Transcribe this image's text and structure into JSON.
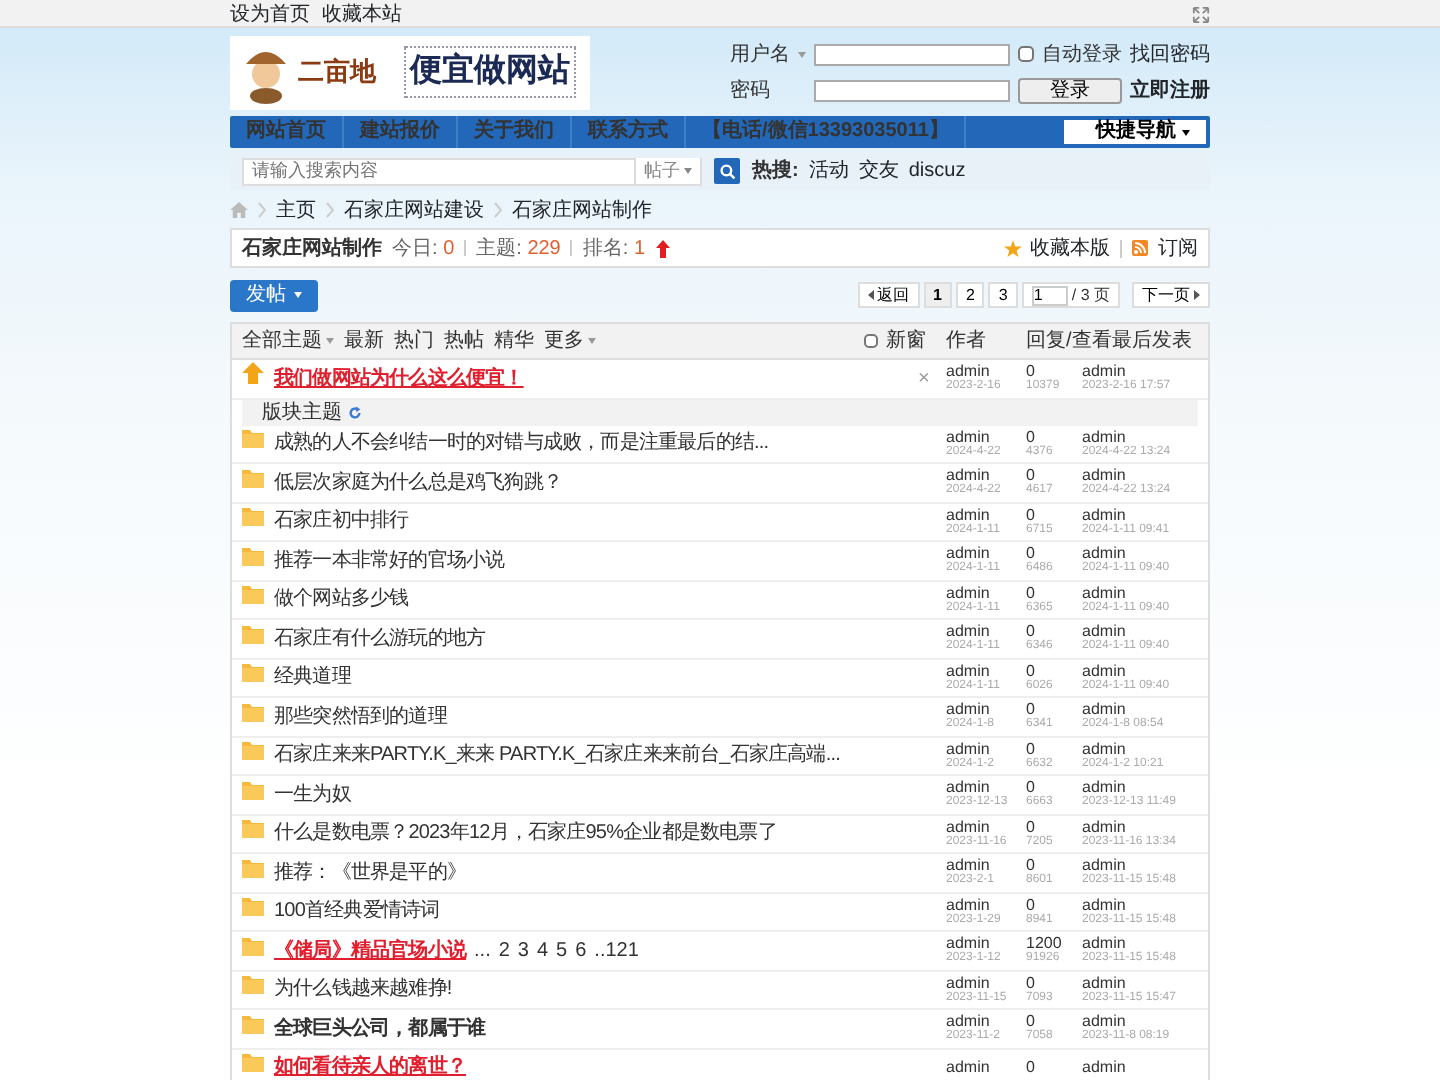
{
  "topbar": {
    "links": [
      "设为首页",
      "收藏本站"
    ]
  },
  "logo": {
    "brand": "二亩地",
    "slogan": "便宜做网站"
  },
  "login": {
    "username_label": "用户名",
    "password_label": "密码",
    "remember": {
      "label": "自动登录",
      "checked": false
    },
    "forgot": "找回密码",
    "submit": "登录",
    "register": "立即注册"
  },
  "nav": {
    "items": [
      "网站首页",
      "建站报价",
      "关于我们",
      "联系方式",
      "【电话/微信13393035011】"
    ],
    "quick": "快捷导航"
  },
  "search": {
    "placeholder": "请输入搜索内容",
    "scope": "帖子",
    "hot_label": "热搜:",
    "hot": [
      "活动",
      "交友",
      "discuz"
    ]
  },
  "breadcrumb": [
    "主页",
    "石家庄网站建设",
    "石家庄网站制作"
  ],
  "forum": {
    "title": "石家庄网站制作",
    "stats": [
      {
        "label": "今日:",
        "value": "0"
      },
      {
        "label": "主题:",
        "value": "229"
      },
      {
        "label": "排名:",
        "value": "1"
      }
    ],
    "favorite": "收藏本版",
    "subscribe": "订阅"
  },
  "post_button": "发帖",
  "pagination": {
    "back": "返回",
    "pages": [
      {
        "label": "1",
        "selected": true
      },
      {
        "label": "2",
        "selected": false
      },
      {
        "label": "3",
        "selected": false
      }
    ],
    "page_input": "1",
    "total": "/ 3 页",
    "next": "下一页"
  },
  "filters": {
    "items": [
      {
        "label": "全部主题",
        "dropdown": true
      },
      {
        "label": "最新",
        "dropdown": false
      },
      {
        "label": "热门",
        "dropdown": false
      },
      {
        "label": "热帖",
        "dropdown": false
      },
      {
        "label": "精华",
        "dropdown": false
      },
      {
        "label": "更多",
        "dropdown": true
      }
    ],
    "new_window": {
      "label": "新窗",
      "checked": false
    },
    "author_col": "作者",
    "count_col": "回复/查看",
    "last_col": "最后发表"
  },
  "section_label": "版块主题",
  "threads": [
    {
      "kind": "pinned",
      "title": "我们做网站为什么这么便宜！",
      "highlighted": true,
      "bold": true,
      "close": "×",
      "author": "admin",
      "date": "2023-2-16",
      "replies": "0",
      "views": "10379",
      "last_user": "admin",
      "last_time": "2023-2-16 17:57"
    },
    {
      "kind": "section"
    },
    {
      "kind": "normal",
      "title": "成熟的人不会纠结一时的对错与成败，而是注重最后的结...",
      "highlighted": false,
      "bold": false,
      "author": "admin",
      "date": "2024-4-22",
      "replies": "0",
      "views": "4376",
      "last_user": "admin",
      "last_time": "2024-4-22 13:24"
    },
    {
      "kind": "normal",
      "title": "低层次家庭为什么总是鸡飞狗跳？",
      "highlighted": false,
      "bold": false,
      "author": "admin",
      "date": "2024-4-22",
      "replies": "0",
      "views": "4617",
      "last_user": "admin",
      "last_time": "2024-4-22 13:24"
    },
    {
      "kind": "normal",
      "title": "石家庄初中排行",
      "highlighted": false,
      "bold": false,
      "author": "admin",
      "date": "2024-1-11",
      "replies": "0",
      "views": "6715",
      "last_user": "admin",
      "last_time": "2024-1-11 09:41"
    },
    {
      "kind": "normal",
      "title": "推荐一本非常好的官场小说",
      "highlighted": false,
      "bold": false,
      "author": "admin",
      "date": "2024-1-11",
      "replies": "0",
      "views": "6486",
      "last_user": "admin",
      "last_time": "2024-1-11 09:40"
    },
    {
      "kind": "normal",
      "title": "做个网站多少钱",
      "highlighted": false,
      "bold": false,
      "author": "admin",
      "date": "2024-1-11",
      "replies": "0",
      "views": "6365",
      "last_user": "admin",
      "last_time": "2024-1-11 09:40"
    },
    {
      "kind": "normal",
      "title": "石家庄有什么游玩的地方",
      "highlighted": false,
      "bold": false,
      "author": "admin",
      "date": "2024-1-11",
      "replies": "0",
      "views": "6346",
      "last_user": "admin",
      "last_time": "2024-1-11 09:40"
    },
    {
      "kind": "normal",
      "title": "经典道理",
      "highlighted": false,
      "bold": false,
      "author": "admin",
      "date": "2024-1-11",
      "replies": "0",
      "views": "6026",
      "last_user": "admin",
      "last_time": "2024-1-11 09:40"
    },
    {
      "kind": "normal",
      "title": "那些突然悟到的道理",
      "highlighted": false,
      "bold": false,
      "author": "admin",
      "date": "2024-1-8",
      "replies": "0",
      "views": "6341",
      "last_user": "admin",
      "last_time": "2024-1-8 08:54"
    },
    {
      "kind": "normal",
      "title": "石家庄来来PARTY.K_来来 PARTY.K_石家庄来来前台_石家庄高端...",
      "highlighted": false,
      "bold": false,
      "author": "admin",
      "date": "2024-1-2",
      "replies": "0",
      "views": "6632",
      "last_user": "admin",
      "last_time": "2024-1-2 10:21"
    },
    {
      "kind": "normal",
      "title": "一生为奴",
      "highlighted": false,
      "bold": false,
      "author": "admin",
      "date": "2023-12-13",
      "replies": "0",
      "views": "6663",
      "last_user": "admin",
      "last_time": "2023-12-13 11:49"
    },
    {
      "kind": "normal",
      "title": "什么是数电票？2023年12月，石家庄95%企业都是数电票了",
      "highlighted": false,
      "bold": false,
      "author": "admin",
      "date": "2023-11-16",
      "replies": "0",
      "views": "7205",
      "last_user": "admin",
      "last_time": "2023-11-16 13:34"
    },
    {
      "kind": "normal",
      "title": "推荐：《世界是平的》",
      "highlighted": false,
      "bold": false,
      "author": "admin",
      "date": "2023-2-1",
      "replies": "0",
      "views": "8601",
      "last_user": "admin",
      "last_time": "2023-11-15 15:48"
    },
    {
      "kind": "normal",
      "title": "100首经典爱情诗词",
      "highlighted": false,
      "bold": false,
      "author": "admin",
      "date": "2023-1-29",
      "replies": "0",
      "views": "8941",
      "last_user": "admin",
      "last_time": "2023-11-15 15:48"
    },
    {
      "kind": "normal",
      "title": "《储局》精品官场小说",
      "highlighted": true,
      "bold": true,
      "pages": [
        "...",
        "2",
        "3",
        "4",
        "5",
        "6",
        "..121"
      ],
      "author": "admin",
      "date": "2023-1-12",
      "replies": "1200",
      "views": "91926",
      "last_user": "admin",
      "last_time": "2023-11-15 15:48"
    },
    {
      "kind": "normal",
      "title": "为什么钱越来越难挣!",
      "highlighted": false,
      "bold": false,
      "author": "admin",
      "date": "2023-11-15",
      "replies": "0",
      "views": "7093",
      "last_user": "admin",
      "last_time": "2023-11-15 15:47"
    },
    {
      "kind": "normal",
      "title": "全球巨头公司，都属于谁",
      "highlighted": false,
      "bold": true,
      "author": "admin",
      "date": "2023-11-2",
      "replies": "0",
      "views": "7058",
      "last_user": "admin",
      "last_time": "2023-11-8 08:19"
    },
    {
      "kind": "normal",
      "title": "如何看待亲人的离世？",
      "highlighted": true,
      "bold": true,
      "author": "admin",
      "replies": "0",
      "last_user": "admin"
    }
  ]
}
